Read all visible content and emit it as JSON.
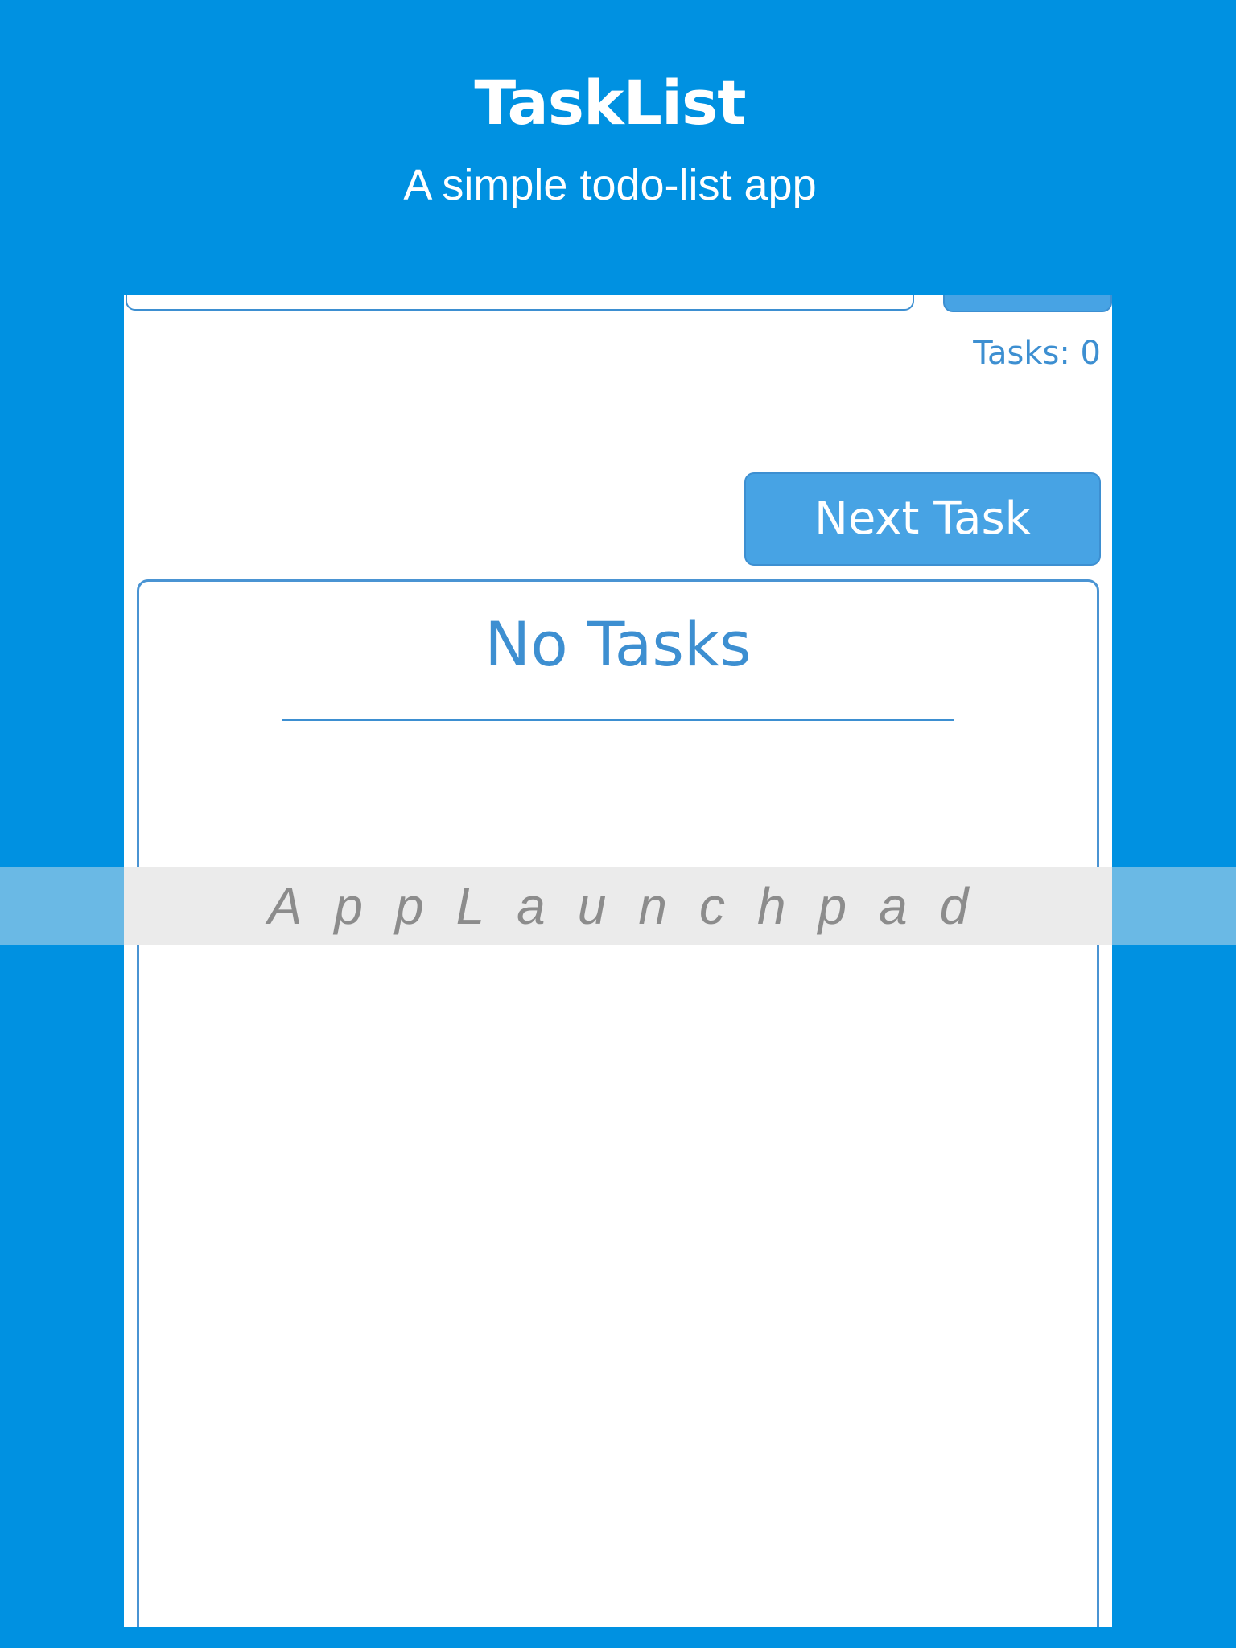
{
  "header": {
    "title": "TaskList",
    "subtitle": "A simple todo-list app"
  },
  "app": {
    "task_input_value": "",
    "task_count": "Tasks: 0",
    "next_button_label": "Next Task",
    "panel_heading": "No Tasks"
  },
  "watermark": {
    "text": "AppLaunchpad"
  },
  "colors": {
    "background": "#0091e1",
    "accent": "#47a3e4",
    "border": "#3d8fd1",
    "text_blue": "#3d8fd1",
    "watermark_band": "#ebebeb",
    "watermark_text": "#8c8c8c"
  },
  "icons": {}
}
